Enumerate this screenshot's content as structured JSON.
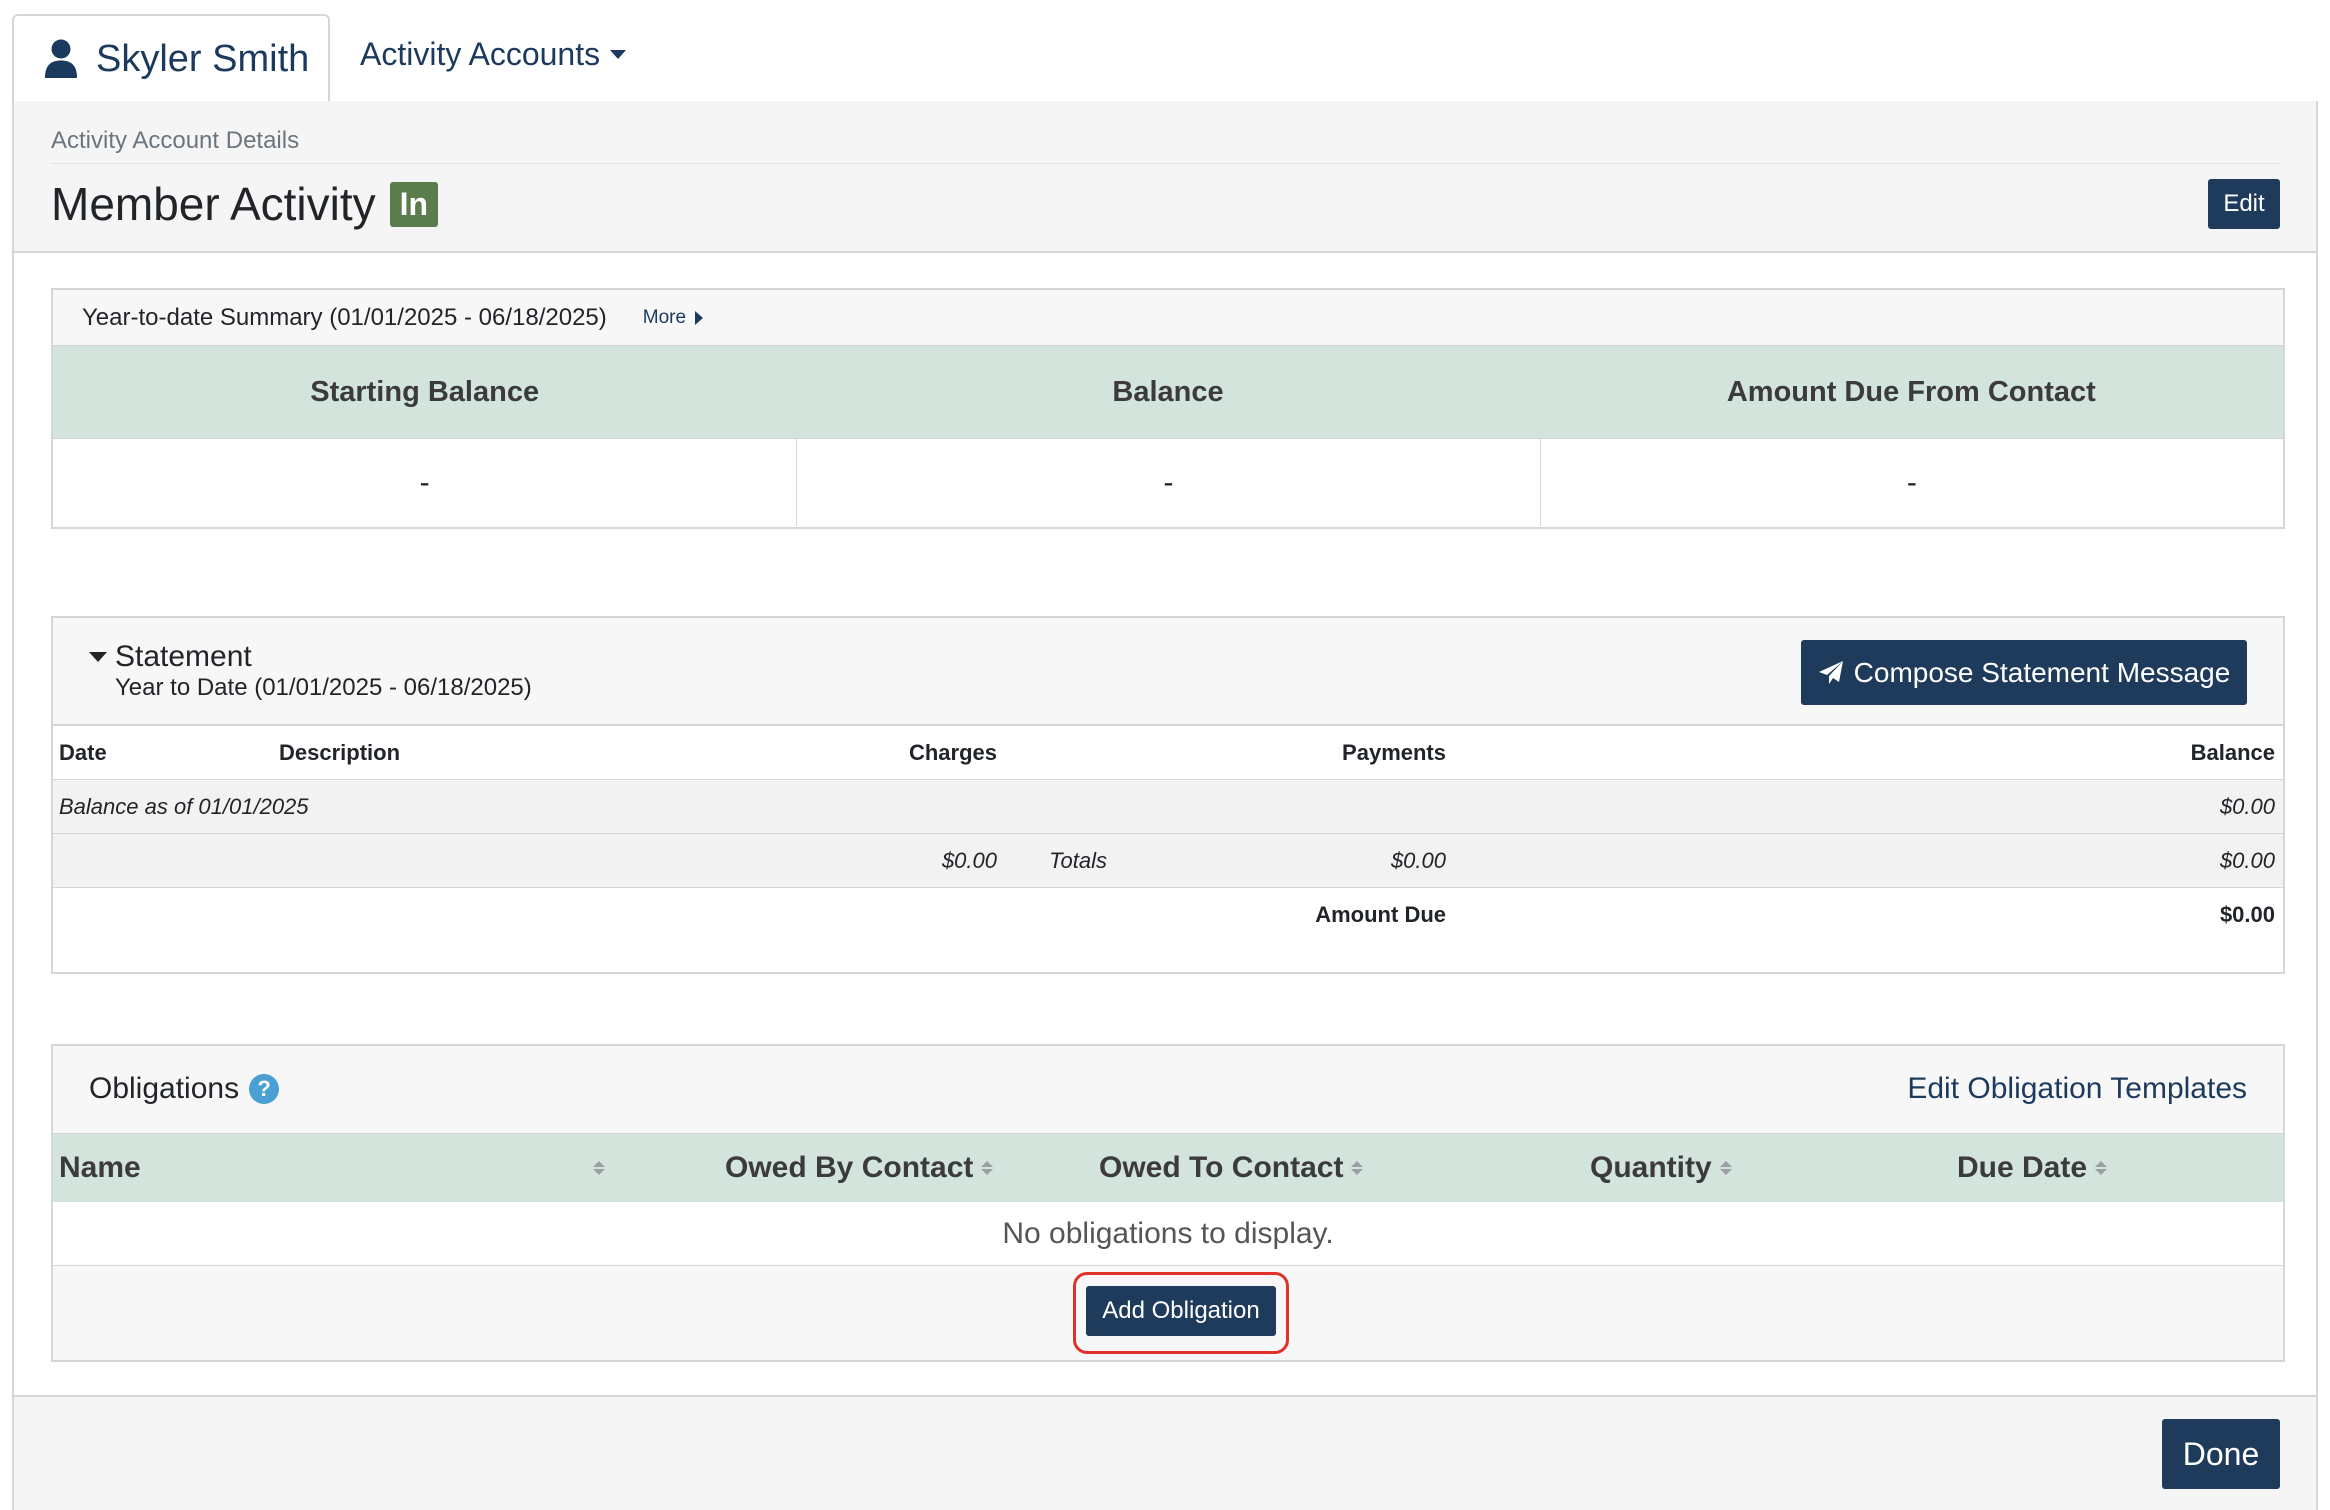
{
  "tabs": {
    "user_name": "Skyler Smith",
    "activity_accounts": "Activity Accounts"
  },
  "header": {
    "breadcrumb": "Activity Account Details",
    "title": "Member Activity",
    "badge": "In",
    "edit_label": "Edit"
  },
  "ytd": {
    "title": "Year-to-date Summary (01/01/2025 - 06/18/2025)",
    "more_label": "More",
    "columns": [
      "Starting Balance",
      "Balance",
      "Amount Due From Contact"
    ],
    "values": [
      "-",
      "-",
      "-"
    ]
  },
  "statement": {
    "title": "Statement",
    "subtitle": "Year to Date (01/01/2025 - 06/18/2025)",
    "compose_label": "Compose Statement Message",
    "headers": {
      "date": "Date",
      "description": "Description",
      "charges": "Charges",
      "payments": "Payments",
      "balance": "Balance"
    },
    "opening": {
      "label": "Balance as of 01/01/2025",
      "balance": "$0.00"
    },
    "totals": {
      "label": "Totals",
      "charges": "$0.00",
      "payments": "$0.00",
      "balance": "$0.00"
    },
    "amount_due": {
      "label": "Amount Due",
      "value": "$0.00"
    }
  },
  "obligations": {
    "title": "Obligations",
    "help": "?",
    "edit_templates_label": "Edit Obligation Templates",
    "columns": [
      "Name",
      "Owed By Contact",
      "Owed To Contact",
      "Quantity",
      "Due Date"
    ],
    "empty_text": "No obligations to display.",
    "add_label": "Add Obligation"
  },
  "footer": {
    "done_label": "Done"
  },
  "colors": {
    "primary_button": "#1f3b5c",
    "table_header": "#d3e4dc",
    "badge_in": "#5b7c4d",
    "highlight": "#e0322b",
    "help_icon": "#4a9fd4"
  }
}
